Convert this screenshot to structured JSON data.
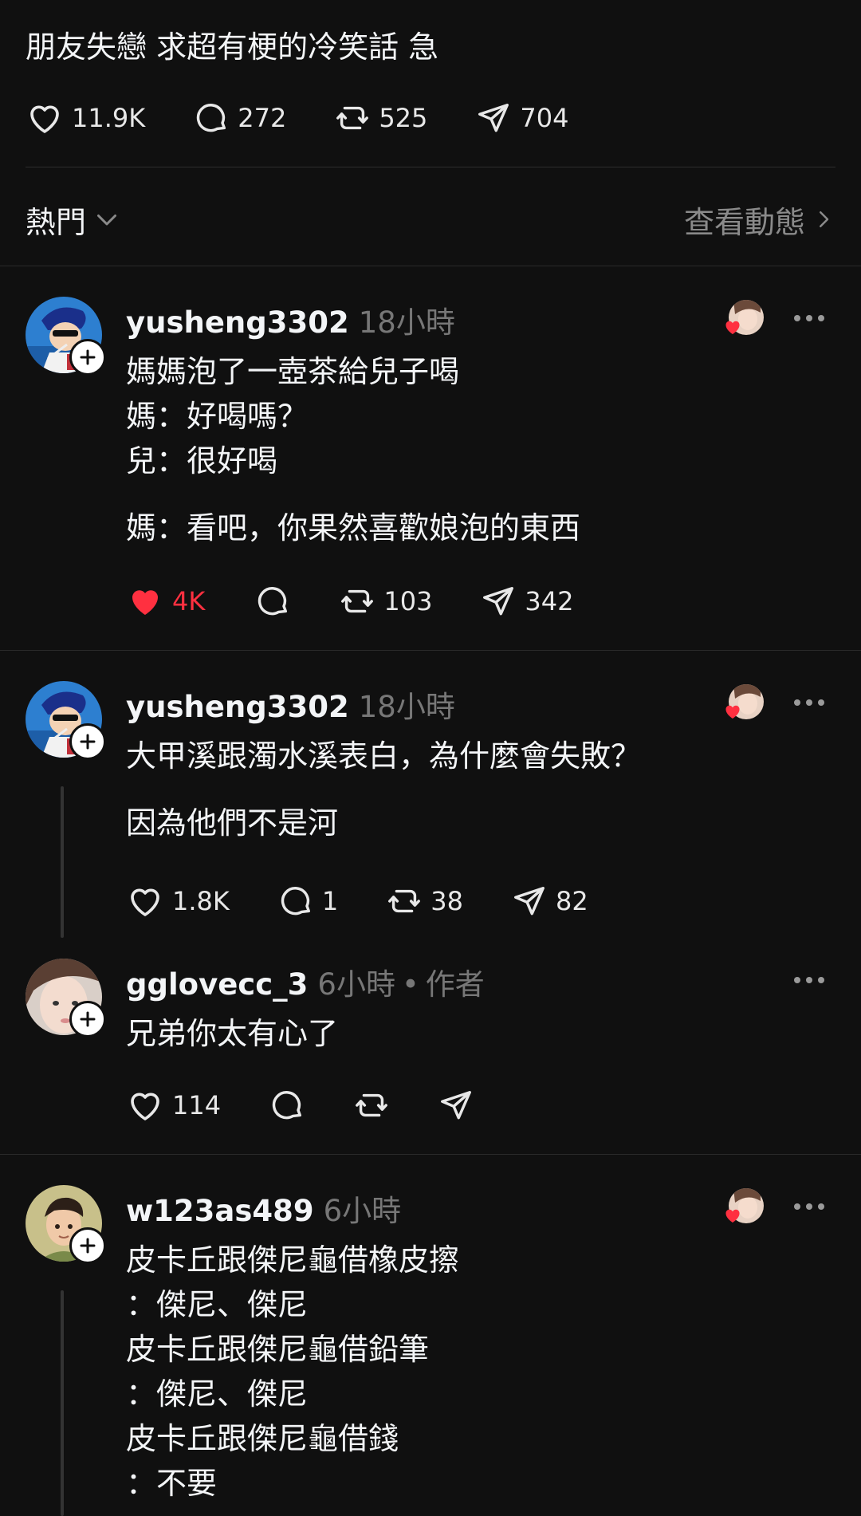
{
  "post": {
    "title": "朋友失戀 求超有梗的冷笑話 急",
    "likes": "11.9K",
    "comments": "272",
    "reposts": "525",
    "shares": "704"
  },
  "sort": {
    "label": "熱門",
    "view_activity": "查看動態"
  },
  "replies": [
    {
      "username": "yusheng3302",
      "time": "18小時",
      "lines": [
        "媽媽泡了一壺茶給兒子喝",
        "媽：好喝嗎？",
        "兒：很好喝"
      ],
      "punchline": "媽：看吧，你果然喜歡娘泡的東西",
      "likes": "4K",
      "comments": "",
      "reposts": "103",
      "shares": "342",
      "liked": true
    },
    {
      "username": "yusheng3302",
      "time": "18小時",
      "lines": [
        "大甲溪跟濁水溪表白，為什麼會失敗？"
      ],
      "punchline": "因為他們不是河",
      "likes": "1.8K",
      "comments": "1",
      "reposts": "38",
      "shares": "82",
      "liked": false
    },
    {
      "username": "gglovecc_3",
      "time": "6小時",
      "author_tag": "作者",
      "separator": "•",
      "lines": [
        "兄弟你太有心了"
      ],
      "likes": "114",
      "comments": "",
      "reposts": "",
      "shares": "",
      "liked": false
    },
    {
      "username": "w123as489",
      "time": "6小時",
      "lines": [
        "皮卡丘跟傑尼龜借橡皮擦",
        "：傑尼、傑尼",
        "皮卡丘跟傑尼龜借鉛筆",
        "：傑尼、傑尼",
        "皮卡丘跟傑尼龜借錢",
        "：不要"
      ]
    }
  ],
  "colors": {
    "background": "#101010",
    "text": "#f3f5f7",
    "muted": "#777777",
    "like_red": "#ff3040"
  },
  "icons": [
    "heart-icon",
    "comment-icon",
    "repost-icon",
    "share-icon",
    "chevron-down-icon",
    "chevron-right-icon",
    "more-icon",
    "plus-icon"
  ]
}
